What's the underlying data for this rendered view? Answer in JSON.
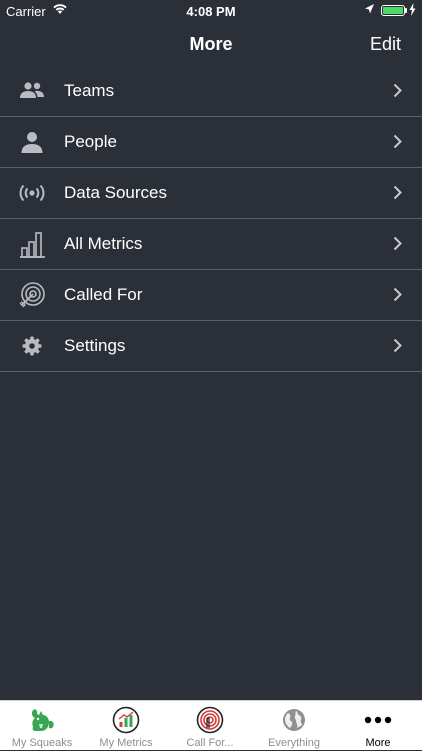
{
  "status_bar": {
    "carrier": "Carrier",
    "time": "4:08 PM"
  },
  "nav": {
    "title": "More",
    "edit_label": "Edit"
  },
  "menu": {
    "items": [
      {
        "label": "Teams",
        "icon": "people-group-icon"
      },
      {
        "label": "People",
        "icon": "person-icon"
      },
      {
        "label": "Data Sources",
        "icon": "broadcast-icon"
      },
      {
        "label": "All Metrics",
        "icon": "bar-chart-icon"
      },
      {
        "label": "Called For",
        "icon": "target-icon"
      },
      {
        "label": "Settings",
        "icon": "gear-icon"
      }
    ]
  },
  "tab_bar": {
    "tabs": [
      {
        "label": "My Squeaks",
        "icon": "squirrel-icon"
      },
      {
        "label": "My Metrics",
        "icon": "metrics-icon"
      },
      {
        "label": "Call For...",
        "icon": "target-tab-icon"
      },
      {
        "label": "Everything",
        "icon": "globe-icon"
      },
      {
        "label": "More",
        "icon": "more-dots-icon",
        "active": true
      }
    ]
  },
  "colors": {
    "background": "#2b3038",
    "divider": "#5a6068",
    "icon_gray": "#b8bcc2",
    "battery": "#4cd964"
  }
}
